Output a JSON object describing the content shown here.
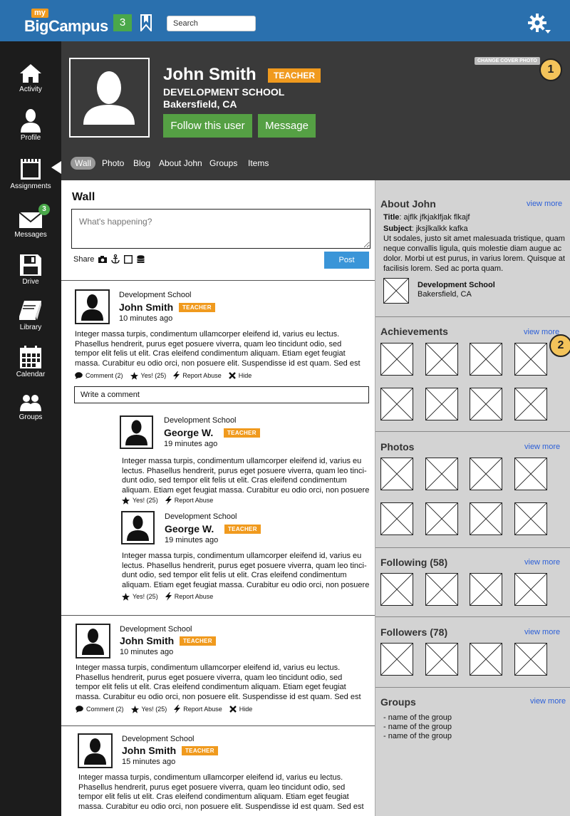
{
  "topbar": {
    "logo_my": "my",
    "logo_brand": "BigCampus",
    "notification_count": "3",
    "search_placeholder": "Search"
  },
  "sidenav": {
    "items": [
      {
        "label": "Activity",
        "icon": "home-icon"
      },
      {
        "label": "Profile",
        "icon": "user-icon"
      },
      {
        "label": "Assignments",
        "icon": "notepad-icon"
      },
      {
        "label": "Messages",
        "icon": "envelope-icon",
        "badge": "3"
      },
      {
        "label": "Drive",
        "icon": "floppy-icon"
      },
      {
        "label": "Library",
        "icon": "book-icon"
      },
      {
        "label": "Calendar",
        "icon": "calendar-icon"
      },
      {
        "label": "Groups",
        "icon": "group-icon"
      }
    ]
  },
  "profile": {
    "name": "John Smith",
    "role_badge": "TEACHER",
    "school": "DEVELOPMENT SCHOOL",
    "city": "Bakersfield, CA",
    "follow_label": "Follow this user",
    "message_label": "Message",
    "change_cover_label": "CHANGE COVER PHOTO",
    "callout_1": "1",
    "callout_2": "2"
  },
  "tabs": [
    "Wall",
    "Photo",
    "Blog",
    "About John",
    "Groups",
    "Items"
  ],
  "wall": {
    "title": "Wall",
    "composer_placeholder": "What's happening?",
    "share_label": "Share",
    "post_label": "Post",
    "comment_placeholder": "Write a comment"
  },
  "posts": [
    {
      "school": "Development School",
      "name": "John Smith",
      "badge": "TEACHER",
      "time": "10 minutes ago",
      "body": "Integer massa turpis, condimentum ullamcorper eleifend id, varius eu lectus. Phasellus hendrerit, purus eget posuere viverra, quam leo tincidunt odio, sed tempor elit felis ut elit. Cras eleifend condimentum aliquam. Etiam eget feugiat massa. Curabitur eu odio orci, non posuere elit. Suspendisse id est quam. Sed est",
      "actions": {
        "comment": "Comment (2)",
        "yes": "Yes! (25)",
        "report": "Report Abuse",
        "hide": "Hide"
      }
    },
    {
      "school": "Development School",
      "name": "George W.",
      "badge": "TEACHER",
      "time": "19 minutes ago",
      "body": "Integer massa turpis, condimentum ullamcorper eleifend id, varius eu lectus. Phasellus hendrerit, purus eget posuere viverra, quam leo tinci-dunt odio, sed tempor elit felis ut elit. Cras eleifend condimentum aliquam. Etiam eget feugiat massa. Curabitur eu odio orci, non posuere",
      "actions": {
        "yes": "Yes! (25)",
        "report": "Report Abuse"
      }
    },
    {
      "school": "Development School",
      "name": "George W.",
      "badge": "TEACHER",
      "time": "19 minutes ago",
      "body": "Integer massa turpis, condimentum ullamcorper eleifend id, varius eu lectus. Phasellus hendrerit, purus eget posuere viverra, quam leo tinci-dunt odio, sed tempor elit felis ut elit. Cras eleifend condimentum aliquam. Etiam eget feugiat massa. Curabitur eu odio orci, non posuere",
      "actions": {
        "yes": "Yes! (25)",
        "report": "Report Abuse"
      }
    },
    {
      "school": "Development School",
      "name": "John Smith",
      "badge": "TEACHER",
      "time": "10 minutes ago",
      "body": "Integer massa turpis, condimentum ullamcorper eleifend id, varius eu lectus. Phasellus hendrerit, purus eget posuere viverra, quam leo tincidunt odio, sed tempor elit felis ut elit. Cras eleifend condimentum aliquam. Etiam eget feugiat massa. Curabitur eu odio orci, non posuere elit. Suspendisse id est quam. Sed est",
      "actions": {
        "comment": "Comment (2)",
        "yes": "Yes! (25)",
        "report": "Report Abuse",
        "hide": "Hide"
      }
    },
    {
      "school": "Development School",
      "name": "John Smith",
      "badge": "TEACHER",
      "time": "15 minutes ago",
      "body": "Integer massa turpis, condimentum ullamcorper eleifend id, varius eu lectus. Phasellus hendrerit, purus eget posuere viverra, quam leo tincidunt odio, sed tempor elit felis ut elit. Cras eleifend condimentum aliquam. Etiam eget feugiat massa. Curabitur eu odio orci, non posuere elit. Suspendisse id est quam. Sed est",
      "actions": {}
    }
  ],
  "about": {
    "title": "About John",
    "view_more": "view more",
    "title_label": "Title",
    "title_value": ": ajflk jfkjaklfjak flkajf",
    "subject_label": "Subject",
    "subject_value": ": jksjlkalkk kafka",
    "text": "Ut sodales, justo sit amet malesuada tristique, quam neque convallis ligula, quis molestie diam augue ac dolor. Morbi ut est purus, in varius lorem. Quisque at facilisis lorem. Sed ac porta quam.",
    "school_name": "Development School",
    "school_city": "Bakersfield, CA"
  },
  "achievements": {
    "title": "Achievements",
    "view_more": "view more"
  },
  "photos": {
    "title": "Photos",
    "view_more": "view more"
  },
  "following": {
    "title": "Following (58)",
    "view_more": "view more"
  },
  "followers": {
    "title": "Followers (78)",
    "view_more": "view more"
  },
  "groups": {
    "title": "Groups",
    "view_more": "view more",
    "items": [
      "- name of the group",
      "- name of the group",
      "- name of the group"
    ]
  },
  "colors": {
    "topbar": "#2a70ae",
    "sidenav": "#1c1c1c",
    "header": "#3a3a3a",
    "accent_orange": "#f09a1e",
    "green": "#55a044",
    "post_blue": "#3a95d8",
    "link_blue": "#2b5fd8"
  }
}
